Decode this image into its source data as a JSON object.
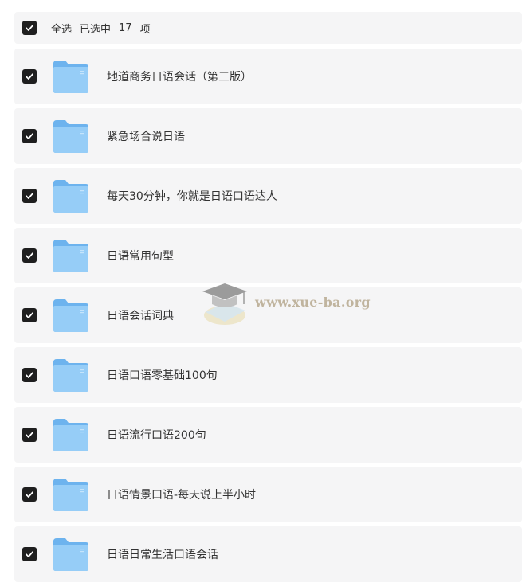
{
  "header": {
    "select_all_label": "全选",
    "selected_prefix": "已选中",
    "selected_count": "17",
    "selected_suffix": "项",
    "checked": true
  },
  "items": [
    {
      "name": "地道商务日语会话（第三版）",
      "checked": true,
      "icon": "folder-icon"
    },
    {
      "name": "紧急场合说日语",
      "checked": true,
      "icon": "folder-icon"
    },
    {
      "name": "每天30分钟，你就是日语口语达人",
      "checked": true,
      "icon": "folder-icon"
    },
    {
      "name": "日语常用句型",
      "checked": true,
      "icon": "folder-icon"
    },
    {
      "name": "日语会话词典",
      "checked": true,
      "icon": "folder-icon"
    },
    {
      "name": "日语口语零基础100句",
      "checked": true,
      "icon": "folder-icon"
    },
    {
      "name": "日语流行口语200句",
      "checked": true,
      "icon": "folder-icon"
    },
    {
      "name": "日语情景口语-每天说上半小时",
      "checked": true,
      "icon": "folder-icon"
    },
    {
      "name": "日语日常生活口语会话",
      "checked": true,
      "icon": "folder-icon"
    }
  ],
  "watermark": {
    "text": "www.xue-ba.org",
    "icon": "graduation-cap-icon"
  },
  "colors": {
    "checkbox": "#1f1f1f",
    "row_bg": "#f5f5f6",
    "folder": "#8ec7f5"
  }
}
